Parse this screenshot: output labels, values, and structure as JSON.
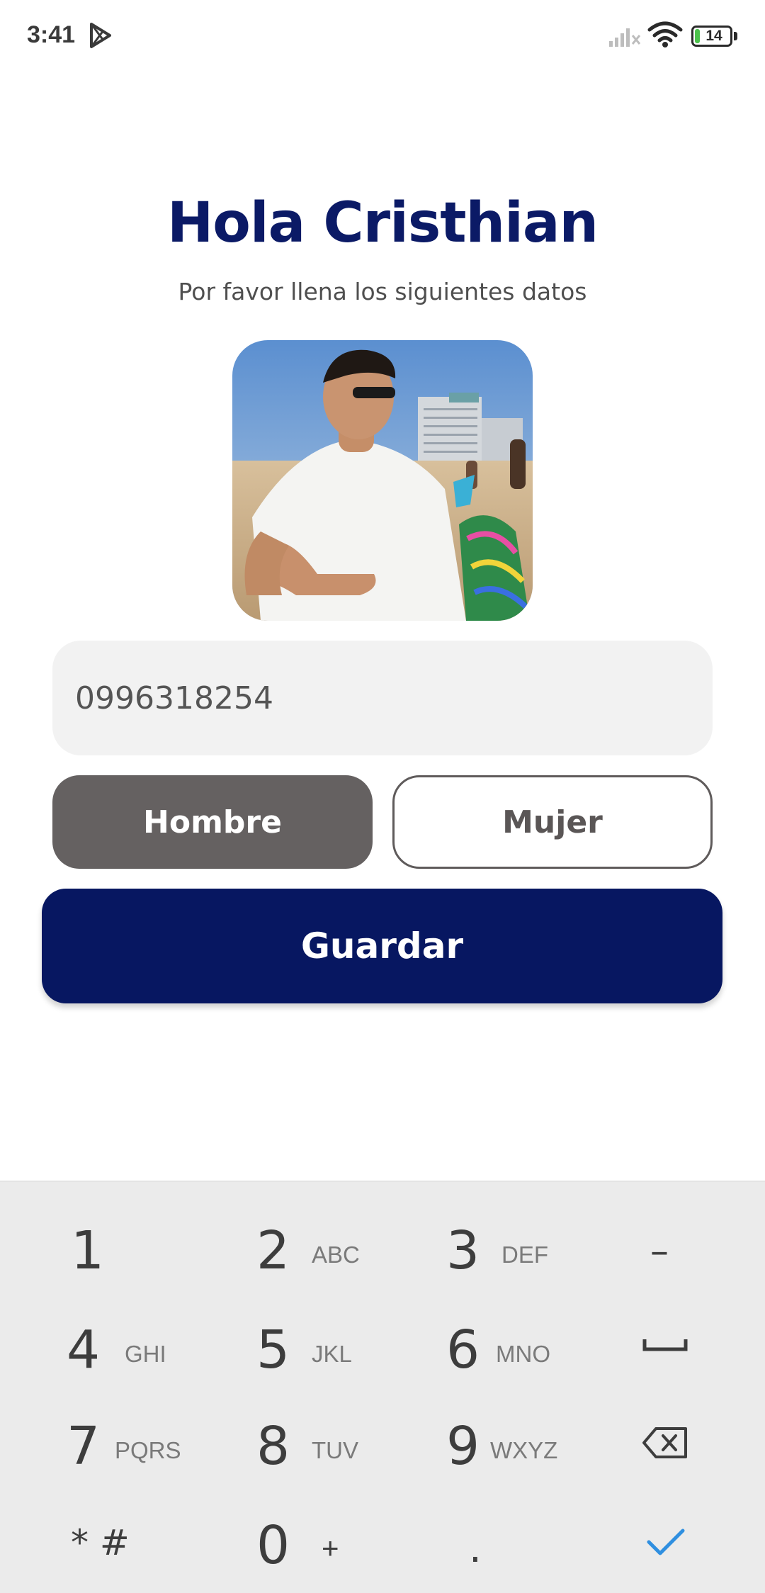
{
  "status_bar": {
    "time": "3:41",
    "battery_level": "14",
    "battery_fraction": 0.14,
    "icons": [
      "play-store-icon",
      "signal-off-icon",
      "wifi-icon",
      "battery-icon"
    ]
  },
  "greeting": "Hola Cristhian",
  "subtitle": "Por favor llena los siguientes datos",
  "profile": {
    "photo": "profile-photo"
  },
  "phone_field": {
    "value": "0996318254"
  },
  "gender": {
    "options": [
      "Hombre",
      "Mujer"
    ],
    "selected": "Hombre"
  },
  "save_label": "Guardar",
  "colors": {
    "primary": "#071761",
    "title": "#0b1a66",
    "selected_option": "#656161",
    "field_bg": "#f2f2f2",
    "keyboard_bg": "#ebebeb",
    "accent_check": "#2f8fe0",
    "battery_green": "#4cc24c"
  },
  "keyboard": {
    "rows": [
      [
        {
          "num": "1",
          "letters": ""
        },
        {
          "num": "2",
          "letters": "ABC"
        },
        {
          "num": "3",
          "letters": "DEF"
        },
        {
          "sym": "–",
          "name": "minus-key"
        }
      ],
      [
        {
          "num": "4",
          "letters": "GHI"
        },
        {
          "num": "5",
          "letters": "JKL"
        },
        {
          "num": "6",
          "letters": "MNO"
        },
        {
          "icon": "space-icon",
          "name": "space-key"
        }
      ],
      [
        {
          "num": "7",
          "letters": "PQRS"
        },
        {
          "num": "8",
          "letters": "TUV"
        },
        {
          "num": "9",
          "letters": "WXYZ"
        },
        {
          "icon": "backspace-icon",
          "name": "backspace-key"
        }
      ],
      [
        {
          "sym": "* #",
          "name": "star-hash-key"
        },
        {
          "num": "0",
          "letters": "+"
        },
        {
          "sym": ".",
          "name": "period-key"
        },
        {
          "icon": "checkmark-icon",
          "name": "done-key"
        }
      ]
    ]
  }
}
